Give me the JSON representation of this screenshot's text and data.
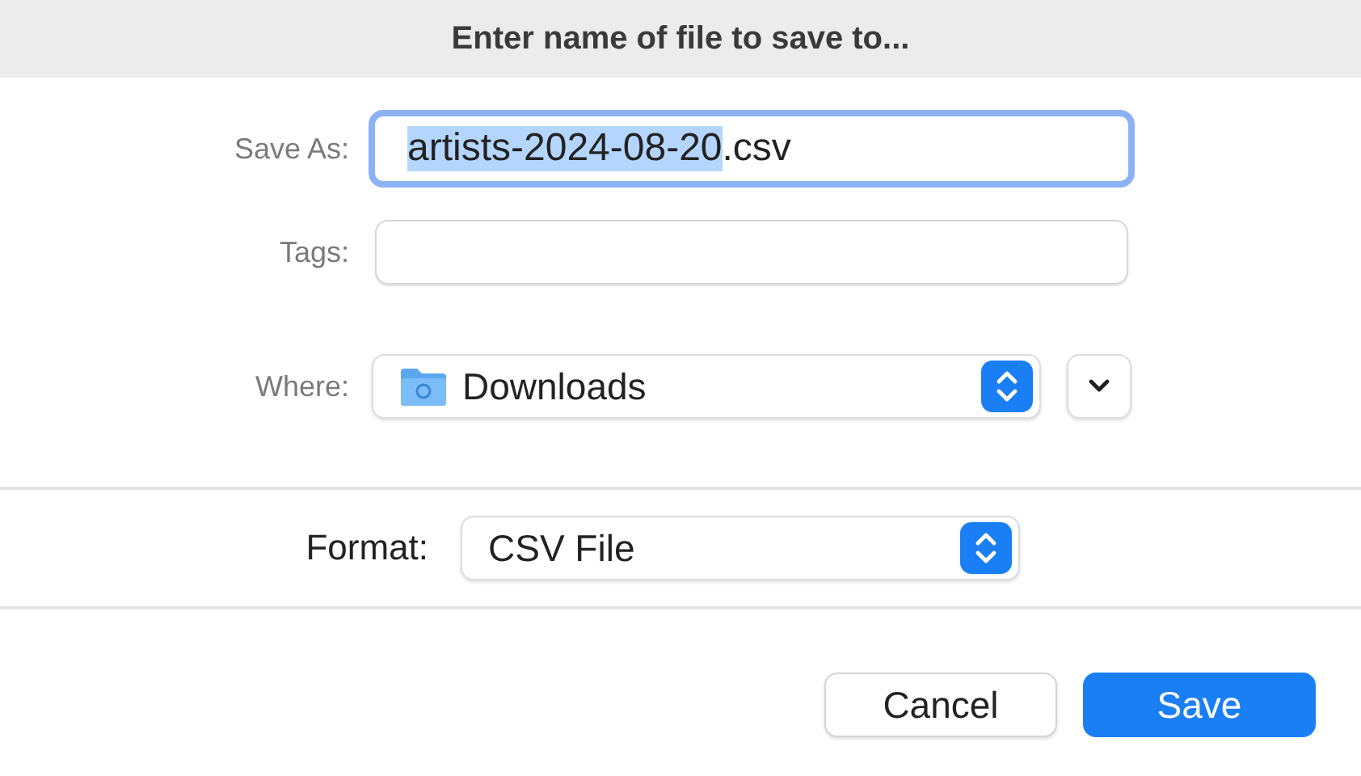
{
  "window": {
    "title": "Enter name of file to save to..."
  },
  "save_as": {
    "label": "Save As:",
    "focused": true,
    "value_parts": [
      {
        "text": "artists-2024-08-20",
        "selected": true
      },
      {
        "text": ".csv",
        "selected": false
      }
    ]
  },
  "tags": {
    "label": "Tags:"
  },
  "where": {
    "label": "Where:",
    "value": "Downloads"
  },
  "format": {
    "label": "Format:",
    "value": "CSV File"
  },
  "buttons": [
    {
      "label": "Cancel",
      "kind": "normal"
    },
    {
      "label": "Save",
      "kind": "default"
    }
  ]
}
